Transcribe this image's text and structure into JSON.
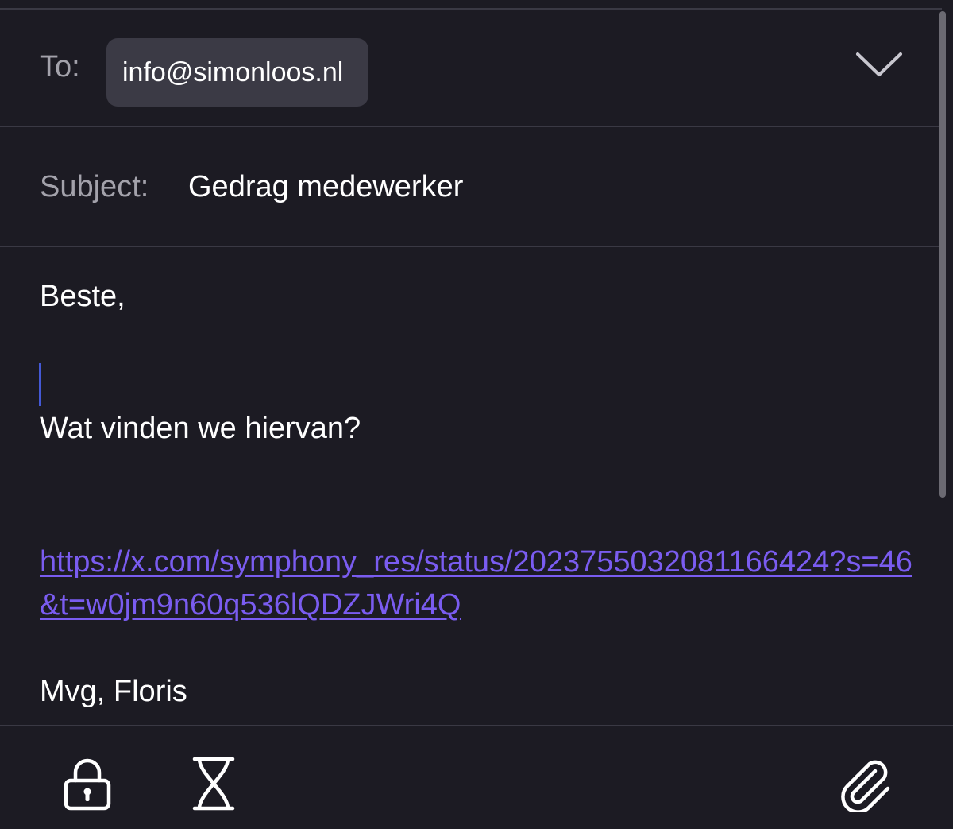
{
  "compose": {
    "to_label": "To:",
    "recipient": "info@simonloos.nl",
    "subject_label": "Subject:",
    "subject": "Gedrag medewerker"
  },
  "body": {
    "greeting": "Beste,",
    "question": "Wat vinden we hiervan?",
    "link": "https://x.com/symphony_res/status/2023755032081166424?s=46&t=w0jm9n60q536lQDZJWri4Q",
    "signature": "Mvg, Floris"
  },
  "toolbar": {
    "icons": [
      "lock-icon",
      "hourglass-icon",
      "paperclip-icon"
    ]
  },
  "colors": {
    "background": "#1c1b23",
    "chip": "#3b3a45",
    "label": "#a3a2ab",
    "link": "#7a5cf0",
    "cursor": "#4459d6"
  }
}
